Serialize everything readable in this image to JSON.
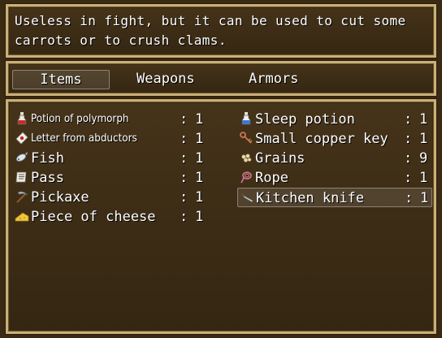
{
  "help": {
    "text": "Useless in fight, but it can be used to cut some\ncarrots or to crush clams."
  },
  "tabs": [
    {
      "label": "Items",
      "selected": true
    },
    {
      "label": "Weapons",
      "selected": false
    },
    {
      "label": "Armors",
      "selected": false
    }
  ],
  "items_left": [
    {
      "name": "Potion of polymorph",
      "colon": ":",
      "qty": "1",
      "icon": "potion-red-icon"
    },
    {
      "name": "Letter from abductors",
      "colon": ":",
      "qty": "1",
      "icon": "letter-icon"
    },
    {
      "name": "Fish",
      "colon": ":",
      "qty": "1",
      "icon": "fish-icon"
    },
    {
      "name": "Pass",
      "colon": ":",
      "qty": "1",
      "icon": "scroll-icon"
    },
    {
      "name": "Pickaxe",
      "colon": ":",
      "qty": "1",
      "icon": "pickaxe-icon"
    },
    {
      "name": "Piece of cheese",
      "colon": ":",
      "qty": "1",
      "icon": "cheese-icon"
    }
  ],
  "items_right": [
    {
      "name": "Sleep potion",
      "colon": ":",
      "qty": "1",
      "icon": "potion-blue-icon"
    },
    {
      "name": "Small copper key",
      "colon": ":",
      "qty": "1",
      "icon": "key-icon"
    },
    {
      "name": "Grains",
      "colon": ":",
      "qty": "9",
      "icon": "grains-icon"
    },
    {
      "name": "Rope",
      "colon": ":",
      "qty": "1",
      "icon": "rope-icon"
    },
    {
      "name": "Kitchen knife",
      "colon": ":",
      "qty": "1",
      "icon": "knife-icon",
      "selected": true
    }
  ]
}
